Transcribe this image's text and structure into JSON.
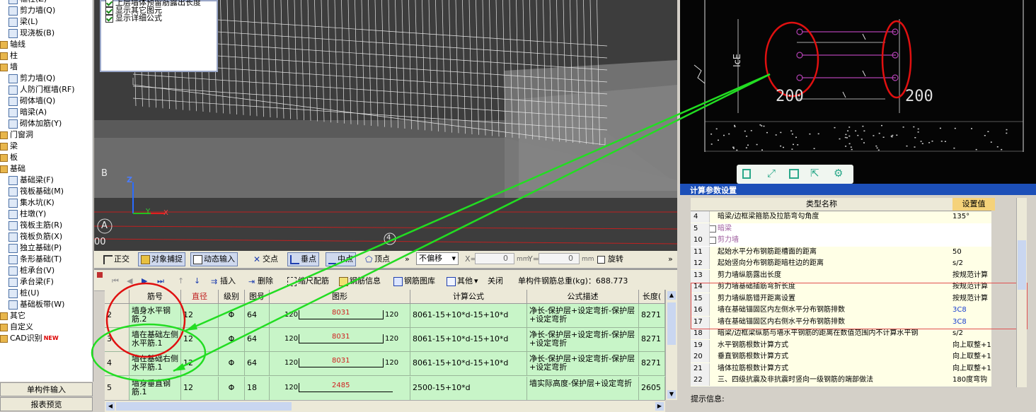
{
  "tree": {
    "items": [
      {
        "label": "框柱(Z)",
        "kind": "node",
        "indent": 12
      },
      {
        "label": "剪力墙(Q)",
        "kind": "node",
        "indent": 12
      },
      {
        "label": "梁(L)",
        "kind": "node",
        "indent": 12
      },
      {
        "label": "现浇板(B)",
        "kind": "node",
        "indent": 12
      },
      {
        "label": "轴线",
        "kind": "folder",
        "indent": 0
      },
      {
        "label": "柱",
        "kind": "folder",
        "indent": 0
      },
      {
        "label": "墙",
        "kind": "folder",
        "indent": 0
      },
      {
        "label": "剪力墙(Q)",
        "kind": "node",
        "indent": 12
      },
      {
        "label": "人防门框墙(RF)",
        "kind": "node",
        "indent": 12
      },
      {
        "label": "砌体墙(Q)",
        "kind": "node",
        "indent": 12
      },
      {
        "label": "暗梁(A)",
        "kind": "node",
        "indent": 12
      },
      {
        "label": "砌体加筋(Y)",
        "kind": "node",
        "indent": 12
      },
      {
        "label": "门窗洞",
        "kind": "folder",
        "indent": 0
      },
      {
        "label": "梁",
        "kind": "folder",
        "indent": 0
      },
      {
        "label": "板",
        "kind": "folder",
        "indent": 0
      },
      {
        "label": "基础",
        "kind": "folder",
        "indent": 0
      },
      {
        "label": "基础梁(F)",
        "kind": "node",
        "indent": 12
      },
      {
        "label": "筏板基础(M)",
        "kind": "node",
        "indent": 12
      },
      {
        "label": "集水坑(K)",
        "kind": "node",
        "indent": 12
      },
      {
        "label": "柱墩(Y)",
        "kind": "node",
        "indent": 12
      },
      {
        "label": "筏板主筋(R)",
        "kind": "node",
        "indent": 12
      },
      {
        "label": "筏板负筋(X)",
        "kind": "node",
        "indent": 12
      },
      {
        "label": "独立基础(P)",
        "kind": "node",
        "indent": 12
      },
      {
        "label": "条形基础(T)",
        "kind": "node",
        "indent": 12
      },
      {
        "label": "桩承台(V)",
        "kind": "node",
        "indent": 12
      },
      {
        "label": "承台梁(F)",
        "kind": "node",
        "indent": 12
      },
      {
        "label": "桩(U)",
        "kind": "node",
        "indent": 12
      },
      {
        "label": "基础板带(W)",
        "kind": "node",
        "indent": 12
      },
      {
        "label": "其它",
        "kind": "folder",
        "indent": 0
      },
      {
        "label": "自定义",
        "kind": "folder",
        "indent": 0
      },
      {
        "label": "CAD识别",
        "kind": "folder",
        "indent": 0,
        "badge": "NEW"
      }
    ],
    "btn_single": "单构件输入",
    "btn_report": "报表预览"
  },
  "view_options": {
    "items": [
      "上层墙体预留筋露出长度",
      "显示其它图元",
      "显示详细公式"
    ]
  },
  "view3d": {
    "axis_z": "Z",
    "axis_y": "Y",
    "axis_x": "X",
    "grid_label_a": "A",
    "grid_label_b": "B",
    "grid_label_4": "4",
    "grid_label_00": "00"
  },
  "snap_toolbar": {
    "ortho": "正交",
    "object_snap": "对象捕捉",
    "dynamic_input": "动态输入",
    "intersection": "交点",
    "perpendicular": "垂点",
    "midpoint": "中点",
    "vertex": "顶点",
    "offset_select": "不偏移",
    "x_label": "X=",
    "x_value": "0",
    "y_label": "Y=",
    "y_value": "0",
    "unit": "mm",
    "rotate": "旋转"
  },
  "rebar_toolbar": {
    "insert": "插入",
    "delete": "删除",
    "scale_config": "缩尺配筋",
    "rebar_info": "钢筋信息",
    "rebar_library": "钢筋图库",
    "other": "其他",
    "close": "关闭",
    "total_weight": "单构件钢筋总重(kg)：688.773"
  },
  "rebar_table": {
    "headers": [
      "筋号",
      "直径(mm)",
      "级别",
      "图号",
      "图形",
      "计算公式",
      "公式描述",
      "长度("
    ],
    "rows": [
      {
        "no": "2",
        "name": "墙身水平钢筋.2",
        "dia": "12",
        "grade": "Φ",
        "fig": "64",
        "left": "120",
        "mid": "8031",
        "right": "120",
        "formula": "8061-15+10*d-15+10*d",
        "desc": "净长-保护层+设定弯折-保护层+设定弯折",
        "len": "8271"
      },
      {
        "no": "3",
        "name": "墙在基础左侧水平筋.1",
        "dia": "12",
        "grade": "Φ",
        "fig": "64",
        "left": "120",
        "mid": "8031",
        "right": "120",
        "formula": "8061-15+10*d-15+10*d",
        "desc": "净长-保护层+设定弯折-保护层+设定弯折",
        "len": "8271"
      },
      {
        "no": "4",
        "name": "墙在基础右侧水平筋.1",
        "dia": "12",
        "grade": "Φ",
        "fig": "64",
        "left": "120",
        "mid": "8031",
        "right": "120",
        "formula": "8061-15+10*d-15+10*d",
        "desc": "净长-保护层+设定弯折-保护层+设定弯折",
        "len": "8271"
      },
      {
        "no": "5",
        "name": "墙身垂直钢筋.1",
        "dia": "12",
        "grade": "Φ",
        "fig": "18",
        "left": "120",
        "mid": "2485",
        "right": "",
        "formula": "2500-15+10*d",
        "desc": "墙实际高度-保护层+设定弯折",
        "len": "2605"
      }
    ]
  },
  "cad": {
    "dim_left": "200",
    "dim_right": "200",
    "dim_vertical": "lcE"
  },
  "params": {
    "title": "计算参数设置",
    "col_type": "类型名称",
    "col_value": "设置值",
    "rows": [
      {
        "n": "4",
        "t": "暗梁/边框梁箍筋及拉筋弯勾角度",
        "v": "135°",
        "grp": false
      },
      {
        "n": "5",
        "t": "暗梁",
        "v": "",
        "grp": true
      },
      {
        "n": "10",
        "t": "剪力墙",
        "v": "",
        "grp": true
      },
      {
        "n": "11",
        "t": "起始水平分布钢筋距槽面的距离",
        "v": "50",
        "grp": false
      },
      {
        "n": "12",
        "t": "起始竖向分布钢筋距暗柱边的距离",
        "v": "s/2",
        "grp": false
      },
      {
        "n": "13",
        "t": "剪力墙纵筋露出长度",
        "v": "按规范计算",
        "grp": false
      },
      {
        "n": "14",
        "t": "剪力墙基础插筋弯折长度",
        "v": "按规范计算",
        "grp": false
      },
      {
        "n": "15",
        "t": "剪力墙纵筋错开距离设置",
        "v": "按规范计算",
        "grp": false
      },
      {
        "n": "16",
        "t": "墙在基础锚固区内左侧水平分布钢筋排数",
        "v": "3C8",
        "grp": false,
        "blue": true
      },
      {
        "n": "17",
        "t": "墙在基础锚固区内右侧水平分布钢筋排数",
        "v": "3C8",
        "grp": false,
        "blue": true
      },
      {
        "n": "18",
        "t": "暗梁/边框梁纵筋与墙水平钢筋的距离在数值范围内不计算水平钢",
        "v": "s/2",
        "grp": false
      },
      {
        "n": "19",
        "t": "水平钢筋根数计算方式",
        "v": "向上取整+1",
        "grp": false
      },
      {
        "n": "20",
        "t": "垂直钢筋根数计算方式",
        "v": "向上取整+1",
        "grp": false
      },
      {
        "n": "21",
        "t": "墙体拉筋根数计算方式",
        "v": "向上取整+1",
        "grp": false
      },
      {
        "n": "22",
        "t": "三、四级抗震及非抗震时竖向一级钢筋的端部做法",
        "v": "180度弯钩",
        "grp": false
      }
    ],
    "hint_label": "提示信息:"
  }
}
